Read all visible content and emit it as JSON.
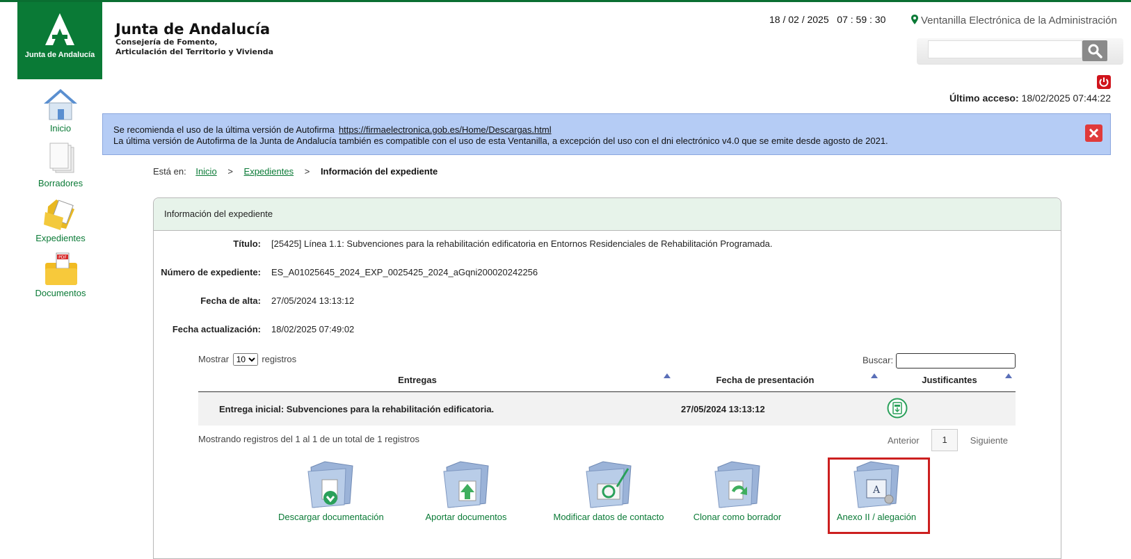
{
  "header": {
    "logo_text": "Junta de Andalucía",
    "org_title": "Junta de Andalucía",
    "org_sub1": "Consejería de Fomento,",
    "org_sub2": "Articulación del Territorio y Vivienda",
    "datetime": "18 / 02 / 2025   07 : 59 : 30",
    "ventanilla": "Ventanilla Electrónica de la Administración",
    "search_placeholder": "",
    "ultimo_label": "Último acceso:",
    "ultimo_value": "18/02/2025 07:44:22"
  },
  "sidebar": {
    "items": [
      {
        "label": "Inicio",
        "icon": "home-icon"
      },
      {
        "label": "Borradores",
        "icon": "drafts-icon"
      },
      {
        "label": "Expedientes",
        "icon": "folder-documents-icon"
      },
      {
        "label": "Documentos",
        "icon": "pdf-folder-icon"
      }
    ]
  },
  "alert": {
    "line1_text": "Se recomienda el uso de la última versión de Autofirma",
    "line1_link": "https://firmaelectronica.gob.es/Home/Descargas.html",
    "line2_text": "La última versión de Autofirma de la Junta de Andalucía también es compatible con el uso de esta Ventanilla, a excepción del uso con el dni electrónico v4.0 que se emite desde agosto de 2021."
  },
  "breadcrumb": {
    "prefix": "Está en:",
    "inicio": "Inicio",
    "sep": ">",
    "expedientes": "Expedientes",
    "current": "Información del expediente"
  },
  "panel": {
    "title": "Información del expediente",
    "fields": [
      {
        "label": "Título:",
        "value": "[25425] Línea 1.1: Subvenciones para la rehabilitación edificatoria en Entornos Residenciales de Rehabilitación Programada."
      },
      {
        "label": "Número de expediente:",
        "value": "ES_A01025645_2024_EXP_0025425_2024_aGqni200020242256"
      },
      {
        "label": "Fecha de alta:",
        "value": "27/05/2024 13:13:12"
      },
      {
        "label": "Fecha actualización:",
        "value": "18/02/2025 07:49:02"
      }
    ]
  },
  "table": {
    "show_label": "Mostrar",
    "show_value": "10",
    "records_label": "registros",
    "search_label": "Buscar:",
    "columns": [
      "Entregas",
      "Fecha de presentación",
      "Justificantes"
    ],
    "rows": [
      {
        "entrega": "Entrega inicial: Subvenciones para la rehabilitación edificatoria.",
        "fecha": "27/05/2024 13:13:12",
        "justificante_icon": "download-receipt-icon"
      }
    ],
    "info": "Mostrando registros del 1 al 1 de un total de 1 registros",
    "prev": "Anterior",
    "page": "1",
    "next": "Siguiente"
  },
  "actions": [
    {
      "label": "Descargar documentación",
      "icon": "download-folder-icon"
    },
    {
      "label": "Aportar documentos",
      "icon": "upload-folder-icon"
    },
    {
      "label": "Modificar datos de contacto",
      "icon": "contact-folder-icon"
    },
    {
      "label": "Clonar como borrador",
      "icon": "clone-folder-icon"
    },
    {
      "label": "Anexo II / alegación",
      "icon": "annex-folder-icon"
    }
  ],
  "colors": {
    "brand_green": "#0a7a36",
    "alert_blue": "#b5ccf5",
    "highlight_red": "#cc1f1f"
  }
}
